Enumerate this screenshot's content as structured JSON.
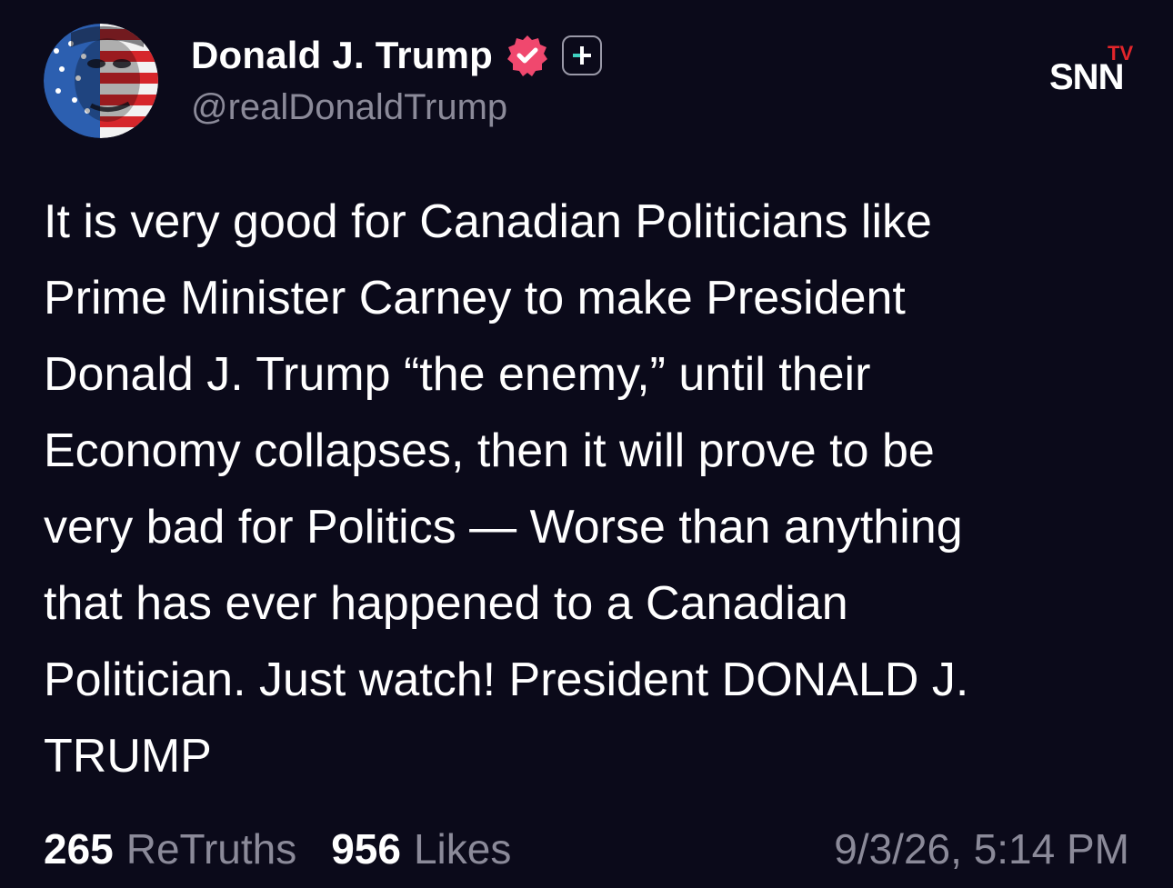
{
  "post": {
    "author": {
      "display_name": "Donald J. Trump",
      "handle": "@realDonaldTrump",
      "verified_icon": "verified-badge-icon",
      "plus_icon": "plus-badge-icon"
    },
    "watermark": {
      "text_main": "SNN",
      "text_tv": "TV"
    },
    "body_lines": [
      "It is very good for Canadian Politicians like",
      "Prime Minister Carney to make President",
      "Donald J. Trump “the enemy,” until their",
      "Economy collapses, then it will prove to be",
      "very bad for Politics — Worse than anything",
      "that has ever happened to a Canadian",
      "Politician. Just watch! President DONALD J.",
      "TRUMP"
    ],
    "stats": {
      "retruths_count": "265",
      "retruths_label": "ReTruths",
      "likes_count": "956",
      "likes_label": "Likes"
    },
    "timestamp": "9/3/26, 5:14 PM"
  },
  "colors": {
    "background": "#0b0a1a",
    "text": "#ffffff",
    "muted": "#8b8a99",
    "verified": "#f0486e",
    "brand_red": "#e4252b"
  }
}
